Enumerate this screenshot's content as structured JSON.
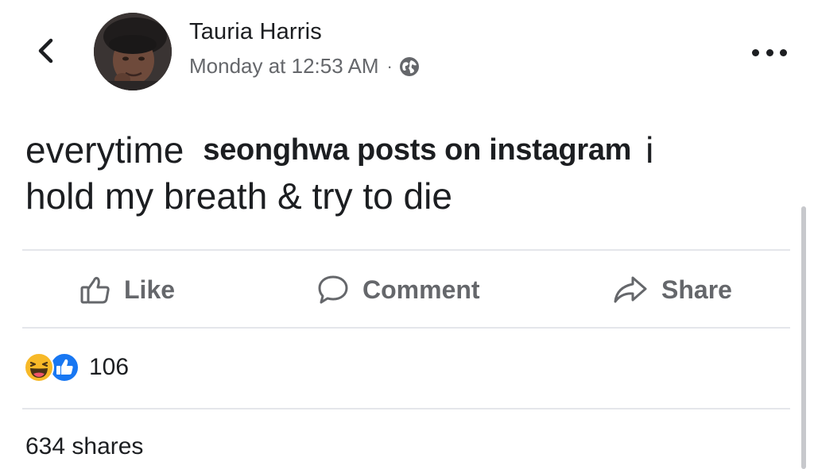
{
  "header": {
    "author_name": "Tauria Harris",
    "timestamp": "Monday at 12:53 AM",
    "separator": "·",
    "privacy_icon": "globe-icon",
    "back_icon": "chevron-left-icon",
    "more_icon": "more-horizontal-icon"
  },
  "post": {
    "line1_start": "everytime",
    "overlay_text": "seonghwa posts on instagram",
    "line1_end": "i",
    "line2": "hold my breath & try to die"
  },
  "actions": {
    "like_label": "Like",
    "comment_label": "Comment",
    "share_label": "Share"
  },
  "reactions": {
    "icons": [
      "haha-reaction-icon",
      "like-reaction-icon"
    ],
    "count": "106"
  },
  "shares": {
    "label": "634 shares"
  },
  "colors": {
    "text_primary": "#1c1e21",
    "text_secondary": "#65676b",
    "divider": "#e4e6eb",
    "like_blue": "#1877f2",
    "haha_yellow": "#f7b928"
  }
}
